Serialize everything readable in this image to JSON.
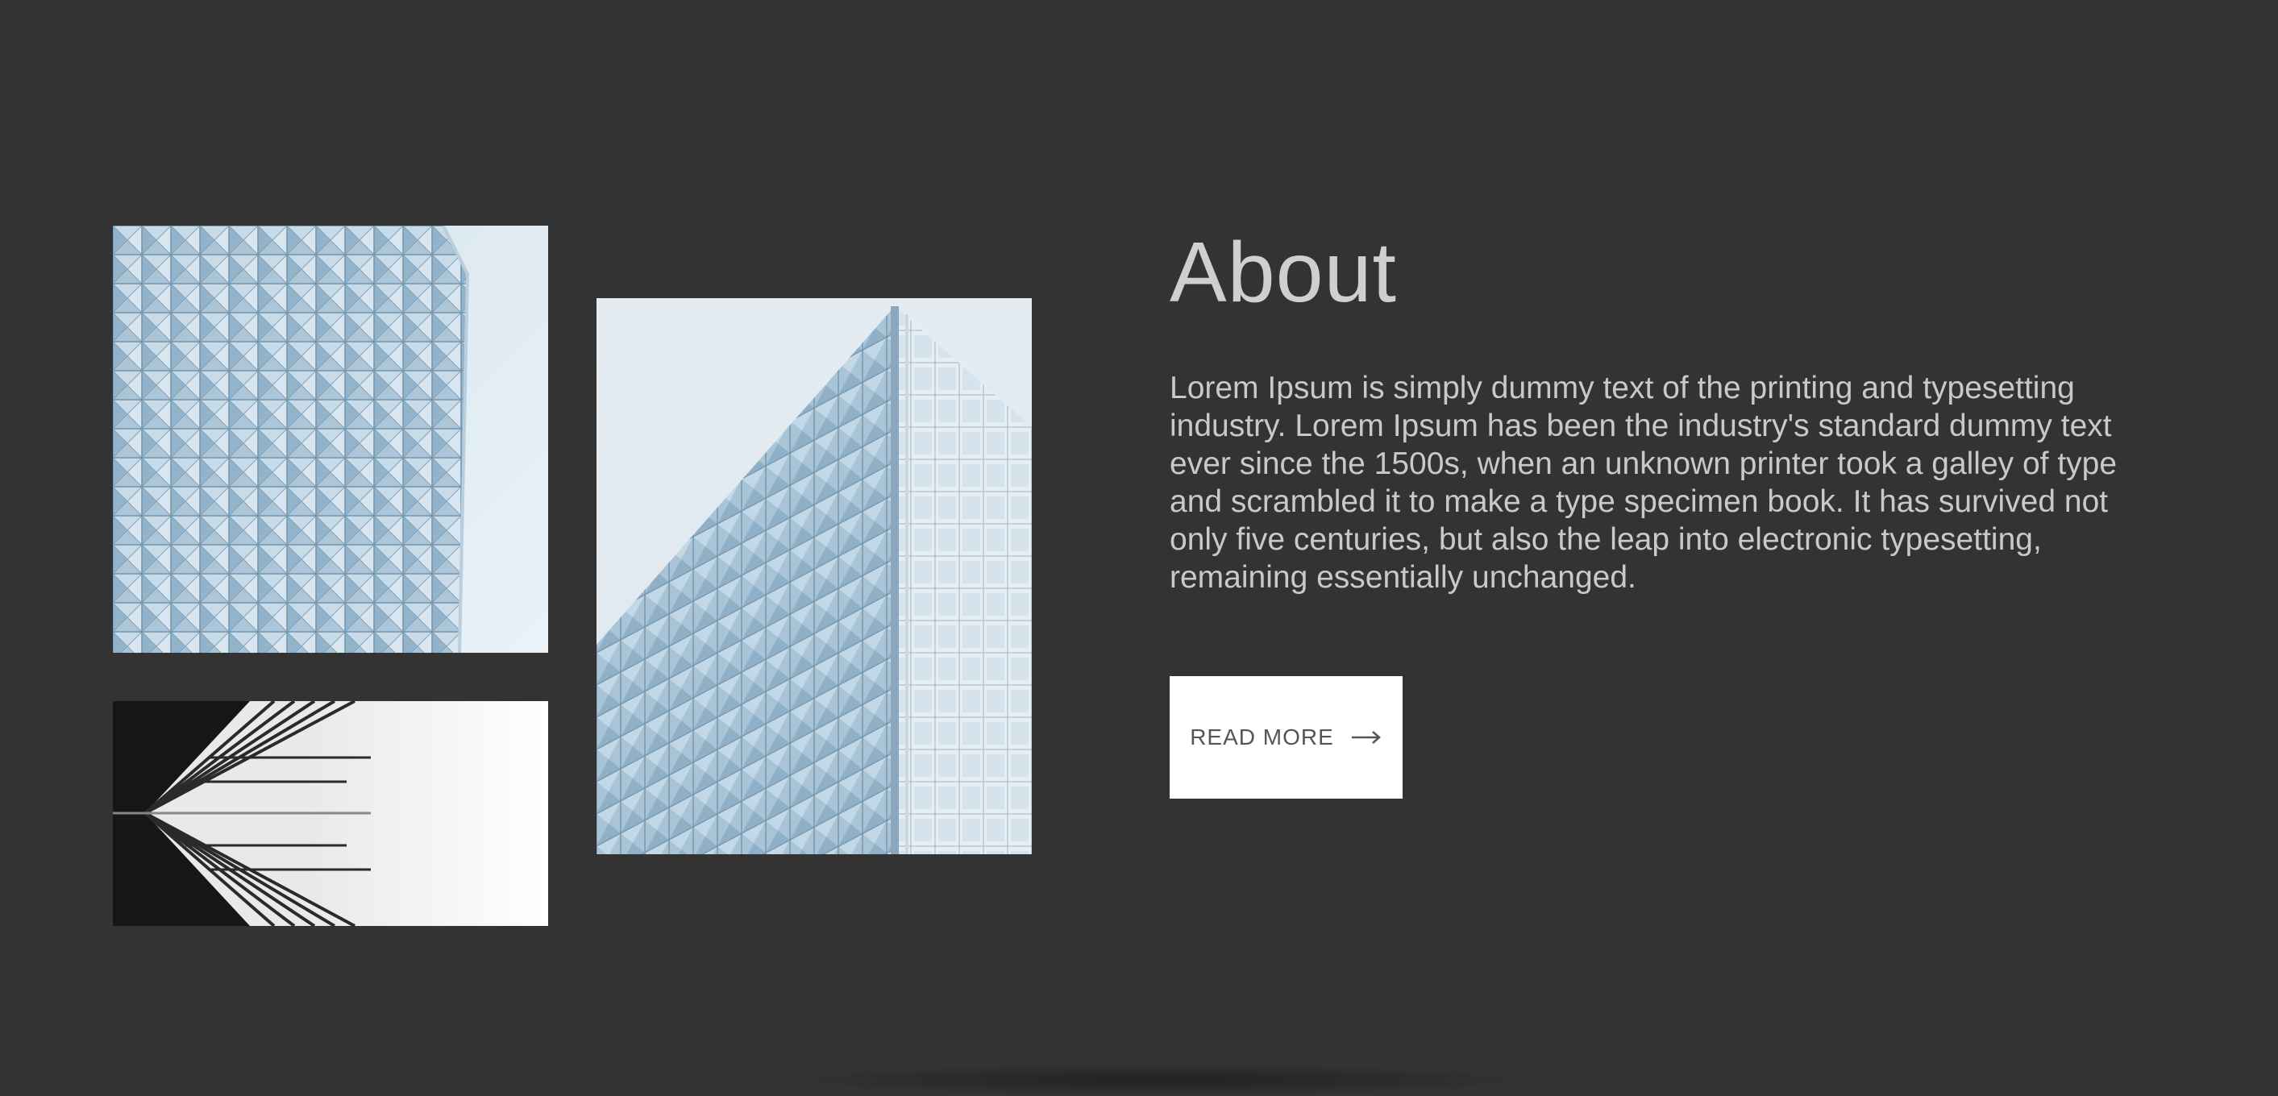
{
  "about": {
    "title": "About",
    "body": "Lorem Ipsum is simply dummy text of the printing and typesetting industry. Lorem Ipsum has been the industry's standard dummy text ever since the 1500s, when an unknown printer took a galley of type and scrambled it to make a type specimen book. It has survived not only five centuries, but also the leap into electronic typesetting, remaining essentially unchanged.",
    "button_label": "READ MORE",
    "button_icon": "arrow-right-icon"
  },
  "colors": {
    "background": "#333333",
    "title": "#cfcfcf",
    "body_text": "#c9c9c9",
    "button_bg": "#ffffff",
    "button_text": "#555555"
  },
  "images": [
    {
      "name": "glass-building-facade",
      "tone": "light blue"
    },
    {
      "name": "glass-towers-mirrored",
      "tone": "black and white"
    },
    {
      "name": "glass-skyscraper-corner",
      "tone": "light blue"
    }
  ]
}
